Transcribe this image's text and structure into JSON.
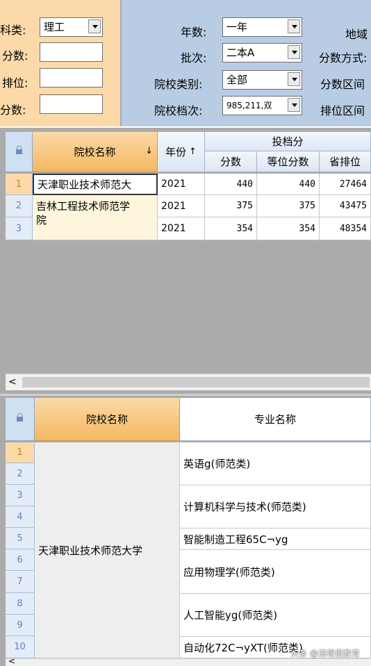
{
  "filters": {
    "subject_label": "科类:",
    "subject_value": "理工",
    "score_label": "分数:",
    "rank_label": "排位:",
    "score2_label": "分数:",
    "years_label": "年数:",
    "years_value": "一年",
    "batch_label": "批次:",
    "batch_value": "二本A",
    "school_type_label": "院校类别:",
    "school_type_value": "全部",
    "school_level_label": "院校档次:",
    "school_level_value": "985,211,双",
    "region_label": "地域",
    "score_mode_label": "分数方式:",
    "score_range_label": "分数区间",
    "rank_range_label": "排位区间"
  },
  "grid1": {
    "col_school": "院校名称",
    "col_year": "年份",
    "group_header": "投档分",
    "col_score": "分数",
    "col_equiv": "等位分数",
    "col_rank": "省排位",
    "rows": [
      {
        "num": "1",
        "school": "天津职业技术师范大",
        "year": "2021",
        "score": "440",
        "equiv": "440",
        "rank": "27464"
      },
      {
        "num": "2",
        "school": "吉林工程技术师范学",
        "school2": "院",
        "year": "2021",
        "score": "375",
        "equiv": "375",
        "rank": "43475"
      },
      {
        "num": "3",
        "school": "",
        "year": "2021",
        "score": "354",
        "equiv": "354",
        "rank": "48354"
      }
    ]
  },
  "grid2": {
    "col_school": "院校名称",
    "col_major": "专业名称",
    "row_nums": [
      "1",
      "2",
      "3",
      "4",
      "5",
      "6",
      "7",
      "8",
      "9",
      "10"
    ],
    "school": "天津职业技术师范大学",
    "majors": [
      "英语g(师范类)",
      "计算机科学与技术(师范类)",
      "智能制造工程65C¬yg",
      "应用物理学(师范类)",
      "人工智能yg(师范类)",
      "自动化72C¬yXT(师范类)"
    ]
  },
  "watermark": "头条 @涛哥侃教育"
}
